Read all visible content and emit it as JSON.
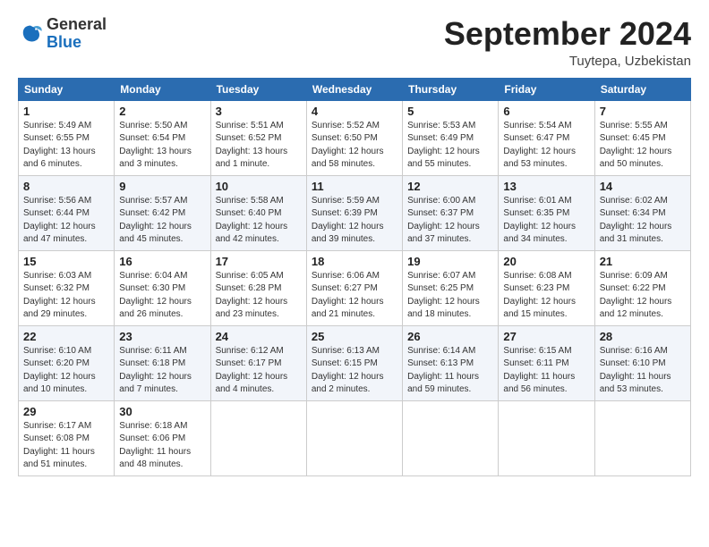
{
  "header": {
    "logo_general": "General",
    "logo_blue": "Blue",
    "month_title": "September 2024",
    "location": "Tuytepa, Uzbekistan"
  },
  "weekdays": [
    "Sunday",
    "Monday",
    "Tuesday",
    "Wednesday",
    "Thursday",
    "Friday",
    "Saturday"
  ],
  "weeks": [
    [
      {
        "day": "1",
        "sunrise": "Sunrise: 5:49 AM",
        "sunset": "Sunset: 6:55 PM",
        "daylight": "Daylight: 13 hours and 6 minutes."
      },
      {
        "day": "2",
        "sunrise": "Sunrise: 5:50 AM",
        "sunset": "Sunset: 6:54 PM",
        "daylight": "Daylight: 13 hours and 3 minutes."
      },
      {
        "day": "3",
        "sunrise": "Sunrise: 5:51 AM",
        "sunset": "Sunset: 6:52 PM",
        "daylight": "Daylight: 13 hours and 1 minute."
      },
      {
        "day": "4",
        "sunrise": "Sunrise: 5:52 AM",
        "sunset": "Sunset: 6:50 PM",
        "daylight": "Daylight: 12 hours and 58 minutes."
      },
      {
        "day": "5",
        "sunrise": "Sunrise: 5:53 AM",
        "sunset": "Sunset: 6:49 PM",
        "daylight": "Daylight: 12 hours and 55 minutes."
      },
      {
        "day": "6",
        "sunrise": "Sunrise: 5:54 AM",
        "sunset": "Sunset: 6:47 PM",
        "daylight": "Daylight: 12 hours and 53 minutes."
      },
      {
        "day": "7",
        "sunrise": "Sunrise: 5:55 AM",
        "sunset": "Sunset: 6:45 PM",
        "daylight": "Daylight: 12 hours and 50 minutes."
      }
    ],
    [
      {
        "day": "8",
        "sunrise": "Sunrise: 5:56 AM",
        "sunset": "Sunset: 6:44 PM",
        "daylight": "Daylight: 12 hours and 47 minutes."
      },
      {
        "day": "9",
        "sunrise": "Sunrise: 5:57 AM",
        "sunset": "Sunset: 6:42 PM",
        "daylight": "Daylight: 12 hours and 45 minutes."
      },
      {
        "day": "10",
        "sunrise": "Sunrise: 5:58 AM",
        "sunset": "Sunset: 6:40 PM",
        "daylight": "Daylight: 12 hours and 42 minutes."
      },
      {
        "day": "11",
        "sunrise": "Sunrise: 5:59 AM",
        "sunset": "Sunset: 6:39 PM",
        "daylight": "Daylight: 12 hours and 39 minutes."
      },
      {
        "day": "12",
        "sunrise": "Sunrise: 6:00 AM",
        "sunset": "Sunset: 6:37 PM",
        "daylight": "Daylight: 12 hours and 37 minutes."
      },
      {
        "day": "13",
        "sunrise": "Sunrise: 6:01 AM",
        "sunset": "Sunset: 6:35 PM",
        "daylight": "Daylight: 12 hours and 34 minutes."
      },
      {
        "day": "14",
        "sunrise": "Sunrise: 6:02 AM",
        "sunset": "Sunset: 6:34 PM",
        "daylight": "Daylight: 12 hours and 31 minutes."
      }
    ],
    [
      {
        "day": "15",
        "sunrise": "Sunrise: 6:03 AM",
        "sunset": "Sunset: 6:32 PM",
        "daylight": "Daylight: 12 hours and 29 minutes."
      },
      {
        "day": "16",
        "sunrise": "Sunrise: 6:04 AM",
        "sunset": "Sunset: 6:30 PM",
        "daylight": "Daylight: 12 hours and 26 minutes."
      },
      {
        "day": "17",
        "sunrise": "Sunrise: 6:05 AM",
        "sunset": "Sunset: 6:28 PM",
        "daylight": "Daylight: 12 hours and 23 minutes."
      },
      {
        "day": "18",
        "sunrise": "Sunrise: 6:06 AM",
        "sunset": "Sunset: 6:27 PM",
        "daylight": "Daylight: 12 hours and 21 minutes."
      },
      {
        "day": "19",
        "sunrise": "Sunrise: 6:07 AM",
        "sunset": "Sunset: 6:25 PM",
        "daylight": "Daylight: 12 hours and 18 minutes."
      },
      {
        "day": "20",
        "sunrise": "Sunrise: 6:08 AM",
        "sunset": "Sunset: 6:23 PM",
        "daylight": "Daylight: 12 hours and 15 minutes."
      },
      {
        "day": "21",
        "sunrise": "Sunrise: 6:09 AM",
        "sunset": "Sunset: 6:22 PM",
        "daylight": "Daylight: 12 hours and 12 minutes."
      }
    ],
    [
      {
        "day": "22",
        "sunrise": "Sunrise: 6:10 AM",
        "sunset": "Sunset: 6:20 PM",
        "daylight": "Daylight: 12 hours and 10 minutes."
      },
      {
        "day": "23",
        "sunrise": "Sunrise: 6:11 AM",
        "sunset": "Sunset: 6:18 PM",
        "daylight": "Daylight: 12 hours and 7 minutes."
      },
      {
        "day": "24",
        "sunrise": "Sunrise: 6:12 AM",
        "sunset": "Sunset: 6:17 PM",
        "daylight": "Daylight: 12 hours and 4 minutes."
      },
      {
        "day": "25",
        "sunrise": "Sunrise: 6:13 AM",
        "sunset": "Sunset: 6:15 PM",
        "daylight": "Daylight: 12 hours and 2 minutes."
      },
      {
        "day": "26",
        "sunrise": "Sunrise: 6:14 AM",
        "sunset": "Sunset: 6:13 PM",
        "daylight": "Daylight: 11 hours and 59 minutes."
      },
      {
        "day": "27",
        "sunrise": "Sunrise: 6:15 AM",
        "sunset": "Sunset: 6:11 PM",
        "daylight": "Daylight: 11 hours and 56 minutes."
      },
      {
        "day": "28",
        "sunrise": "Sunrise: 6:16 AM",
        "sunset": "Sunset: 6:10 PM",
        "daylight": "Daylight: 11 hours and 53 minutes."
      }
    ],
    [
      {
        "day": "29",
        "sunrise": "Sunrise: 6:17 AM",
        "sunset": "Sunset: 6:08 PM",
        "daylight": "Daylight: 11 hours and 51 minutes."
      },
      {
        "day": "30",
        "sunrise": "Sunrise: 6:18 AM",
        "sunset": "Sunset: 6:06 PM",
        "daylight": "Daylight: 11 hours and 48 minutes."
      },
      null,
      null,
      null,
      null,
      null
    ]
  ]
}
